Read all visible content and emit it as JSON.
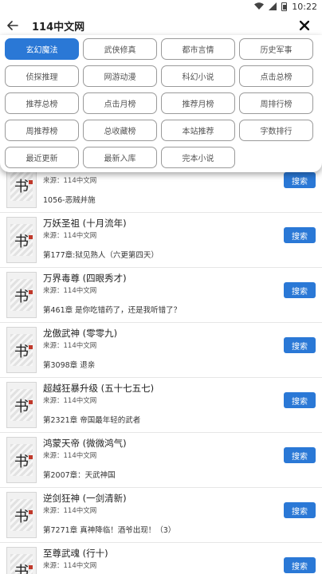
{
  "status_bar": {
    "time": "10:22"
  },
  "app_bar": {
    "title": "114中文网"
  },
  "categories": [
    {
      "label": "玄幻魔法",
      "active": true
    },
    {
      "label": "武侠修真"
    },
    {
      "label": "都市言情"
    },
    {
      "label": "历史军事"
    },
    {
      "label": "侦探推理"
    },
    {
      "label": "网游动漫"
    },
    {
      "label": "科幻小说"
    },
    {
      "label": "点击总榜"
    },
    {
      "label": "推荐总榜"
    },
    {
      "label": "点击月榜"
    },
    {
      "label": "推荐月榜"
    },
    {
      "label": "周排行榜"
    },
    {
      "label": "周推荐榜"
    },
    {
      "label": "总收藏榜"
    },
    {
      "label": "本站推荐"
    },
    {
      "label": "字数排行"
    },
    {
      "label": "最近更新"
    },
    {
      "label": "最新入库"
    },
    {
      "label": "完本小说"
    }
  ],
  "books": [
    {
      "title": "",
      "source": "来源：114中文网",
      "chapter": "1056-恶贼并施",
      "search_label": "搜索"
    },
    {
      "title": "万妖圣祖 (十月流年)",
      "source": "来源：114中文网",
      "chapter": "第177章:狱见熟人（六更第四天）",
      "search_label": "搜索"
    },
    {
      "title": "万界毒尊 (四眼秀才)",
      "source": "来源：114中文网",
      "chapter": "第461章 是你吃错药了，还是我听错了？",
      "search_label": "搜索"
    },
    {
      "title": "龙傲武神 (零零九)",
      "source": "来源：114中文网",
      "chapter": "第3098章 退亲",
      "search_label": "搜索"
    },
    {
      "title": "超越狂暴升级 (五十七五七)",
      "source": "来源：114中文网",
      "chapter": "第2321章 帝国最年轻的武者",
      "search_label": "搜索"
    },
    {
      "title": "鸿蒙天帝 (微微鸿气)",
      "source": "来源：114中文网",
      "chapter": "第2007章：天武神国",
      "search_label": "搜索"
    },
    {
      "title": "逆剑狂神 (一剑清新)",
      "source": "来源：114中文网",
      "chapter": "第7271章 真神降临！酒爷出现！（3）",
      "search_label": "搜索"
    },
    {
      "title": "至尊武魂 (行十)",
      "source": "来源：114中文网",
      "chapter": "",
      "search_label": "搜索"
    }
  ],
  "cover_glyph": "书",
  "colors": {
    "accent": "#2a78d6",
    "panel_bg": "#ffffff",
    "tag_border": "#9a9a9a"
  }
}
